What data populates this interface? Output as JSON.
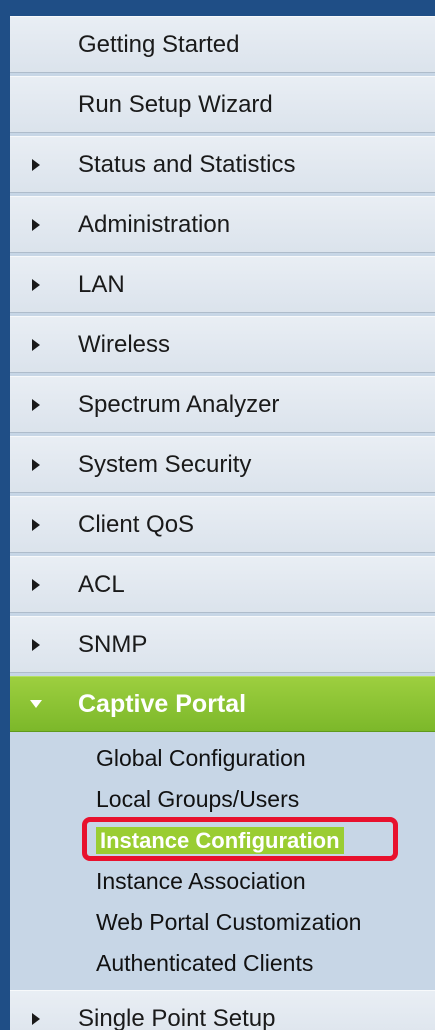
{
  "nav": {
    "items": [
      {
        "label": "Getting Started",
        "has_arrow": false
      },
      {
        "label": "Run Setup Wizard",
        "has_arrow": false
      },
      {
        "label": "Status and Statistics",
        "has_arrow": true
      },
      {
        "label": "Administration",
        "has_arrow": true
      },
      {
        "label": "LAN",
        "has_arrow": true
      },
      {
        "label": "Wireless",
        "has_arrow": true
      },
      {
        "label": "Spectrum Analyzer",
        "has_arrow": true
      },
      {
        "label": "System Security",
        "has_arrow": true
      },
      {
        "label": "Client QoS",
        "has_arrow": true
      },
      {
        "label": "ACL",
        "has_arrow": true
      },
      {
        "label": "SNMP",
        "has_arrow": true
      },
      {
        "label": "Captive Portal",
        "has_arrow": true,
        "expanded": true
      },
      {
        "label": "Single Point Setup",
        "has_arrow": true
      }
    ],
    "captive_portal_submenu": [
      {
        "label": "Global Configuration"
      },
      {
        "label": "Local Groups/Users"
      },
      {
        "label": "Instance Configuration",
        "selected": true
      },
      {
        "label": "Instance Association"
      },
      {
        "label": "Web Portal Customization"
      },
      {
        "label": "Authenticated Clients"
      }
    ]
  },
  "colors": {
    "active_green": "#8cc63f",
    "highlight_red": "#e8112d",
    "nav_bg": "#dbe3ec",
    "page_bg": "#1f4e86"
  },
  "icons": {
    "collapsed": "triangle-right-icon",
    "expanded": "triangle-down-icon"
  }
}
